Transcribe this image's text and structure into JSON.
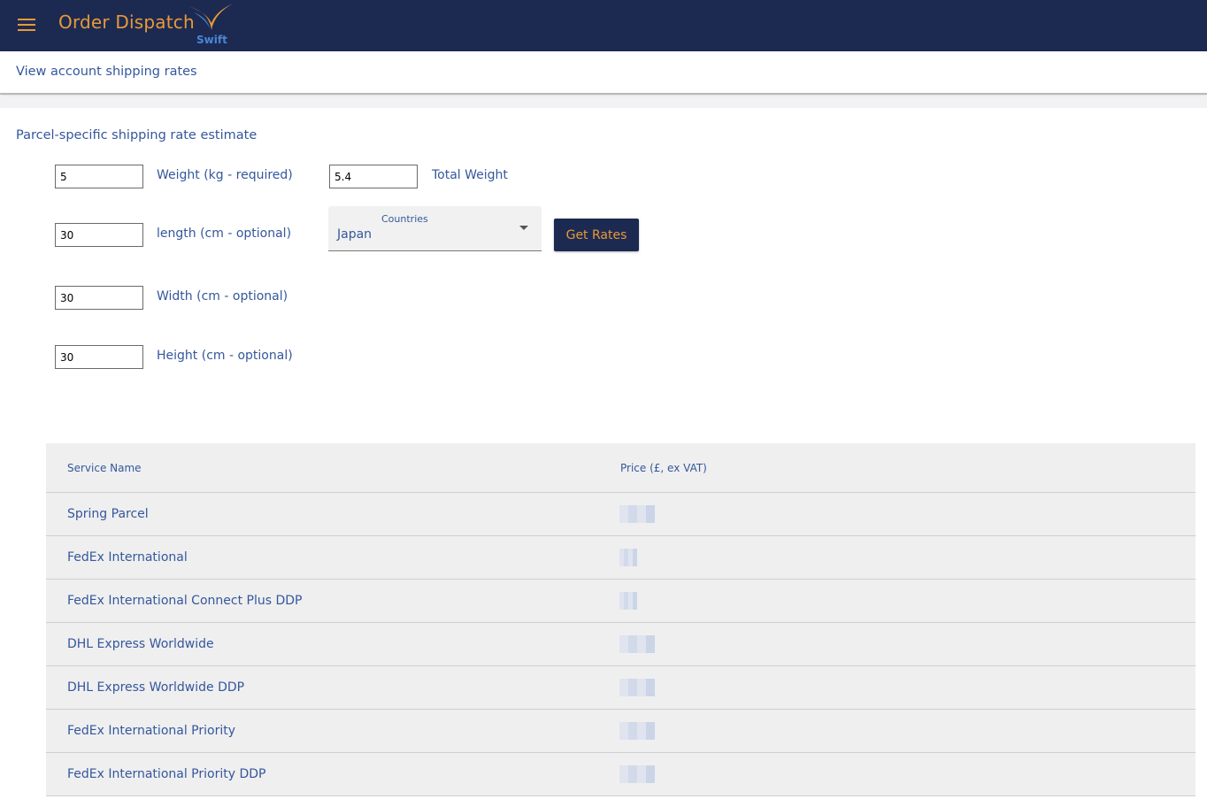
{
  "header": {
    "app_title": "Order Dispatch",
    "logo_text": "Swift",
    "accent_color": "#e99a36",
    "bar_color": "#1c2a52",
    "menu_icon": "hamburger-icon"
  },
  "subnav": {
    "link": "View account shipping rates"
  },
  "form": {
    "section_title": "Parcel-specific shipping rate estimate",
    "weight": {
      "value": "5",
      "label": "Weight (kg - required)"
    },
    "total_weight": {
      "value": "5.4",
      "label": "Total Weight"
    },
    "length": {
      "value": "30",
      "label": "length (cm - optional)"
    },
    "width": {
      "value": "30",
      "label": "Width (cm - optional)"
    },
    "height": {
      "value": "30",
      "label": "Height (cm - optional)"
    },
    "country": {
      "label": "Countries",
      "value": "Japan"
    },
    "get_rates_label": "Get Rates"
  },
  "rates_table": {
    "columns": [
      "Service Name",
      "Price (£, ex VAT)"
    ],
    "rows": [
      {
        "service": "Spring Parcel",
        "price": ""
      },
      {
        "service": "FedEx International",
        "price": ""
      },
      {
        "service": "FedEx International Connect Plus DDP",
        "price": ""
      },
      {
        "service": "DHL Express Worldwide",
        "price": ""
      },
      {
        "service": "DHL Express Worldwide DDP",
        "price": ""
      },
      {
        "service": "FedEx International Priority",
        "price": ""
      },
      {
        "service": "FedEx International Priority DDP",
        "price": ""
      }
    ]
  }
}
